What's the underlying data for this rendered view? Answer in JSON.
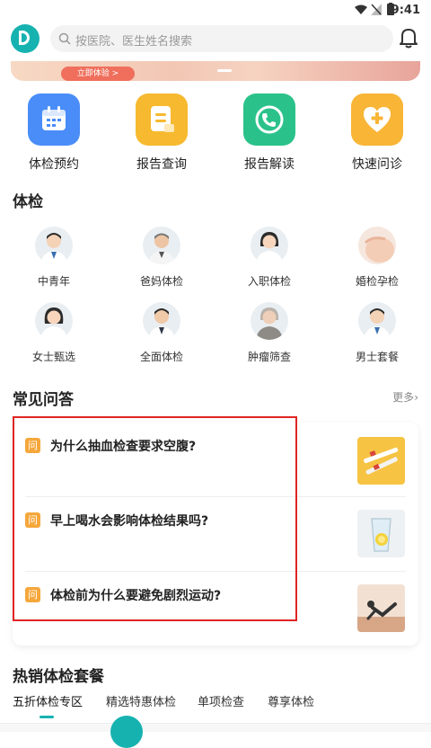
{
  "status_bar": {
    "time": "9:41"
  },
  "header": {
    "logo_icon": "hospital-logo-icon",
    "search_placeholder": "按医院、医生姓名搜索",
    "bell_icon": "bell-icon"
  },
  "banner": {
    "button_label": "立即体验 >"
  },
  "quick_actions": [
    {
      "label": "体检预约",
      "icon": "calendar-icon",
      "color": "#4a8df8"
    },
    {
      "label": "报告查询",
      "icon": "report-icon",
      "color": "#f7b92f"
    },
    {
      "label": "报告解读",
      "icon": "phone-icon",
      "color": "#2ac28a"
    },
    {
      "label": "快速问诊",
      "icon": "heart-plus-icon",
      "color": "#f8b536"
    }
  ],
  "checkup": {
    "title": "体检",
    "categories": [
      {
        "label": "中青年"
      },
      {
        "label": "爸妈体检"
      },
      {
        "label": "入职体检"
      },
      {
        "label": "婚检孕检"
      },
      {
        "label": "女士甄选"
      },
      {
        "label": "全面体检"
      },
      {
        "label": "肿瘤筛查"
      },
      {
        "label": "男士套餐"
      }
    ]
  },
  "faq": {
    "title": "常见问答",
    "more_label": "更多",
    "badge": "问",
    "items": [
      {
        "question": "为什么抽血检查要求空腹?"
      },
      {
        "question": "早上喝水会影响体检结果吗?"
      },
      {
        "question": "体检前为什么要避免剧烈运动?"
      }
    ]
  },
  "hot_packages": {
    "title": "热销体检套餐",
    "tabs": [
      "五折体检专区",
      "精选特惠体检",
      "单项检查",
      "尊享体检"
    ]
  },
  "colors": {
    "brand": "#16b2b0",
    "badge": "#f5a73b"
  }
}
